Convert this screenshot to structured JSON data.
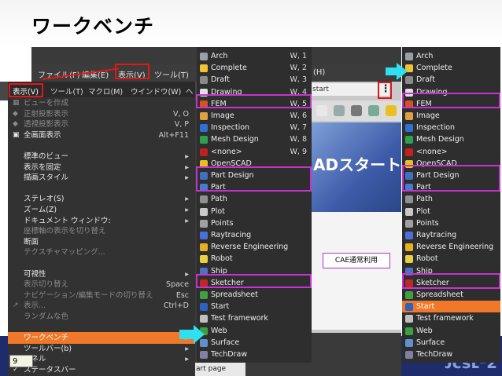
{
  "slide": {
    "title": "ワークベンチ",
    "page_number": "9",
    "logo": "ᴊᴄsʟ²2",
    "cae_label": "CAE通常利用"
  },
  "menubar": [
    "ファイル(F)",
    "編集(E)",
    "表示(V)",
    "ツール(T)"
  ],
  "menubar_extra": "(H)",
  "address_text": "start",
  "start_banner": "ADスタート",
  "tab_label": "art page",
  "view_menu": {
    "header": "表示(V)",
    "header_items": [
      "ツール(T)",
      "マクロ(M)",
      "ウインドウ(W)",
      "ヘ"
    ],
    "items": [
      {
        "label": "ビューを作成",
        "shortcut": "",
        "disabled": true,
        "icon": "▦"
      },
      {
        "label": "正射投影表示",
        "shortcut": "V, O",
        "disabled": true,
        "icon": "◆"
      },
      {
        "label": "透視投影表示",
        "shortcut": "V, P",
        "disabled": true,
        "icon": "◆"
      },
      {
        "label": "全画面表示",
        "shortcut": "Alt+F11",
        "disabled": false,
        "icon": "▣"
      },
      {
        "label": "",
        "shortcut": "",
        "disabled": false,
        "icon": ""
      },
      {
        "label": "標準のビュー",
        "shortcut": "▸",
        "disabled": false,
        "icon": ""
      },
      {
        "label": "表示を固定",
        "shortcut": "▸",
        "disabled": false,
        "icon": ""
      },
      {
        "label": "描画スタイル",
        "shortcut": "▸",
        "disabled": false,
        "icon": ""
      },
      {
        "label": "",
        "shortcut": "",
        "disabled": false,
        "icon": ""
      },
      {
        "label": "ステレオ(S)",
        "shortcut": "▸",
        "disabled": false,
        "icon": ""
      },
      {
        "label": "ズーム(Z)",
        "shortcut": "▸",
        "disabled": false,
        "icon": ""
      },
      {
        "label": "ドキュメント ウィンドウ:",
        "shortcut": "▸",
        "disabled": false,
        "icon": ""
      },
      {
        "label": "座標軸の表示を切り替え",
        "shortcut": "",
        "disabled": true,
        "icon": ""
      },
      {
        "label": "断面",
        "shortcut": "",
        "disabled": false,
        "icon": ""
      },
      {
        "label": "テクスチャマッピング...",
        "shortcut": "",
        "disabled": true,
        "icon": ""
      },
      {
        "label": "",
        "shortcut": "",
        "disabled": false,
        "icon": ""
      },
      {
        "label": "可視性",
        "shortcut": "▸",
        "disabled": false,
        "icon": ""
      },
      {
        "label": "表示切り替え",
        "shortcut": "Space",
        "disabled": true,
        "icon": ""
      },
      {
        "label": "ナビゲーション/編集モードの切り替え",
        "shortcut": "Esc",
        "disabled": true,
        "icon": ""
      },
      {
        "label": "表示...",
        "shortcut": "Ctrl+D",
        "disabled": true,
        "icon": "↗"
      },
      {
        "label": "ランダムな色",
        "shortcut": "",
        "disabled": true,
        "icon": ""
      },
      {
        "label": "",
        "shortcut": "",
        "disabled": false,
        "icon": ""
      },
      {
        "label": "ワークベンチ",
        "shortcut": "▸",
        "disabled": false,
        "icon": "",
        "highlight": true
      },
      {
        "label": "ツールバー(b)",
        "shortcut": "▸",
        "disabled": false,
        "icon": ""
      },
      {
        "label": "パネル",
        "shortcut": "▸",
        "disabled": false,
        "icon": ""
      },
      {
        "label": "ステータスバー",
        "shortcut": "",
        "disabled": false,
        "icon": "✓"
      }
    ]
  },
  "workbench_menu": [
    {
      "name": "Arch",
      "key": "W, 1",
      "color": "#9aa0a8"
    },
    {
      "name": "Complete",
      "key": "W, 2",
      "color": "#f2c230"
    },
    {
      "name": "Draft",
      "key": "W, 3",
      "color": "#8a8a8a"
    },
    {
      "name": "Drawing",
      "key": "W, 4",
      "color": "#e0e0e0"
    },
    {
      "name": "FEM",
      "key": "W, 5",
      "color": "#d85020"
    },
    {
      "name": "Image",
      "key": "W, 6",
      "color": "#e0a040"
    },
    {
      "name": "Inspection",
      "key": "W, 7",
      "color": "#3070d0"
    },
    {
      "name": "Mesh Design",
      "key": "W, 8",
      "color": "#30a050"
    },
    {
      "name": "<none>",
      "key": "W, 9",
      "color": "#c02020"
    },
    {
      "name": "OpenSCAD",
      "key": "",
      "color": "#e8c020"
    },
    {
      "name": "Part Design",
      "key": "",
      "color": "#4070c0"
    },
    {
      "name": "Part",
      "key": "",
      "color": "#4a7ad0"
    },
    {
      "name": "Path",
      "key": "",
      "color": "#909090"
    },
    {
      "name": "Plot",
      "key": "",
      "color": "#c8c8c8"
    },
    {
      "name": "Points",
      "key": "",
      "color": "#a0a0a0"
    },
    {
      "name": "Raytracing",
      "key": "",
      "color": "#4a70d8"
    },
    {
      "name": "Reverse Engineering",
      "key": "",
      "color": "#e8b020"
    },
    {
      "name": "Robot",
      "key": "",
      "color": "#e8d040"
    },
    {
      "name": "Ship",
      "key": "",
      "color": "#5070c0"
    },
    {
      "name": "Sketcher",
      "key": "",
      "color": "#c02828"
    },
    {
      "name": "Spreadsheet",
      "key": "",
      "color": "#40a040"
    },
    {
      "name": "Start",
      "key": "",
      "color": "#3060c0"
    },
    {
      "name": "Test framework",
      "key": "",
      "color": "#c0c0c0"
    },
    {
      "name": "Web",
      "key": "",
      "color": "#3aa040"
    },
    {
      "name": "Surface",
      "key": "",
      "color": "#6090d0"
    },
    {
      "name": "TechDraw",
      "key": "",
      "color": "#8080a0"
    }
  ],
  "workbench_list_right": [
    {
      "name": "Arch",
      "color": "#9aa0a8"
    },
    {
      "name": "Complete",
      "color": "#f2c230"
    },
    {
      "name": "Draft",
      "color": "#8a8a8a"
    },
    {
      "name": "Drawing",
      "color": "#e0e0e0"
    },
    {
      "name": "FEM",
      "color": "#d85020"
    },
    {
      "name": "Image",
      "color": "#e0a040"
    },
    {
      "name": "Inspection",
      "color": "#3070d0"
    },
    {
      "name": "Mesh Design",
      "color": "#30a050"
    },
    {
      "name": "<none>",
      "color": "#c02020"
    },
    {
      "name": "OpenSCAD",
      "color": "#e8c020"
    },
    {
      "name": "Part Design",
      "color": "#4070c0"
    },
    {
      "name": "Part",
      "color": "#4a7ad0"
    },
    {
      "name": "Path",
      "color": "#909090"
    },
    {
      "name": "Plot",
      "color": "#c8c8c8"
    },
    {
      "name": "Points",
      "color": "#a0a0a0"
    },
    {
      "name": "Raytracing",
      "color": "#4a70d8"
    },
    {
      "name": "Reverse Engineering",
      "color": "#e8b020"
    },
    {
      "name": "Robot",
      "color": "#e8d040"
    },
    {
      "name": "Ship",
      "color": "#5070c0"
    },
    {
      "name": "Sketcher",
      "color": "#c02828"
    },
    {
      "name": "Spreadsheet",
      "color": "#40a040"
    },
    {
      "name": "Start",
      "color": "#3060c0",
      "selected": true
    },
    {
      "name": "Test framework",
      "color": "#c0c0c0"
    },
    {
      "name": "Web",
      "color": "#3aa040"
    },
    {
      "name": "Surface",
      "color": "#6090d0"
    },
    {
      "name": "TechDraw",
      "color": "#8080a0"
    }
  ]
}
